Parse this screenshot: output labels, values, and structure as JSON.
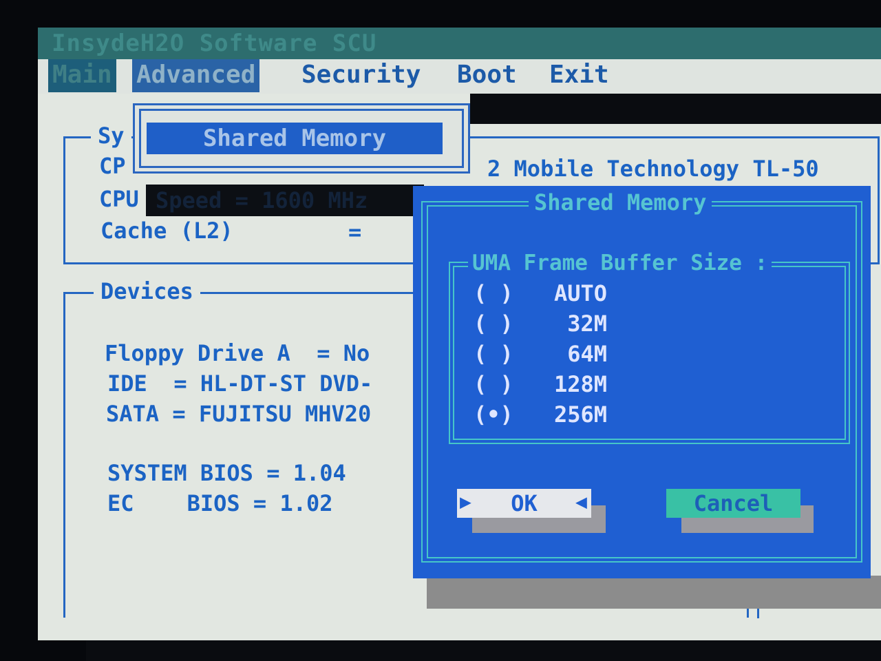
{
  "app": {
    "title": "InsydeH2O Software SCU"
  },
  "menu": {
    "items": [
      {
        "label": "Main",
        "state": "disabled"
      },
      {
        "label": "Advanced",
        "state": "active"
      },
      {
        "label": "Security",
        "state": "normal"
      },
      {
        "label": "Boot",
        "state": "normal"
      },
      {
        "label": "Exit",
        "state": "normal"
      }
    ]
  },
  "submenu": {
    "selected_label": "Shared Memory"
  },
  "system": {
    "legend": "Sy",
    "cpu_row": "CP",
    "cpu_type_tail": "2 Mobile Technology TL-50",
    "cpu_speed_label": "CPU",
    "cpu_speed_obscured": "Speed = 1600 MHz",
    "cache_label": "Cache (L2)",
    "cache_eq": "="
  },
  "devices": {
    "legend": "Devices",
    "floppy": "Floppy Drive A  = No",
    "ide": "IDE  = HL-DT-ST DVD-",
    "sata": "SATA = FUJITSU MHV20",
    "system_bios": "SYSTEM BIOS = 1.04",
    "ec_bios": "EC    BIOS = 1.02"
  },
  "dialog": {
    "title": "Shared Memory",
    "group_label": "UMA Frame Buffer Size :",
    "options": [
      {
        "label": "AUTO",
        "selected": false,
        "radio": "( )"
      },
      {
        "label": "32M",
        "selected": false,
        "radio": "( )"
      },
      {
        "label": "64M",
        "selected": false,
        "radio": "( )"
      },
      {
        "label": "128M",
        "selected": false,
        "radio": "( )"
      },
      {
        "label": "256M",
        "selected": true,
        "radio": "(•)"
      }
    ],
    "ok_label": "OK",
    "cancel_label": "Cancel",
    "ok_arrow_left": "▶",
    "ok_arrow_right": "◀"
  },
  "colors": {
    "screen_bg": "#e2e7e1",
    "bios_blue": "#1b63c4",
    "dialog_bg": "#1f5fd2",
    "dialog_border": "#46c6c8",
    "cancel_bg": "#39c1a5"
  }
}
